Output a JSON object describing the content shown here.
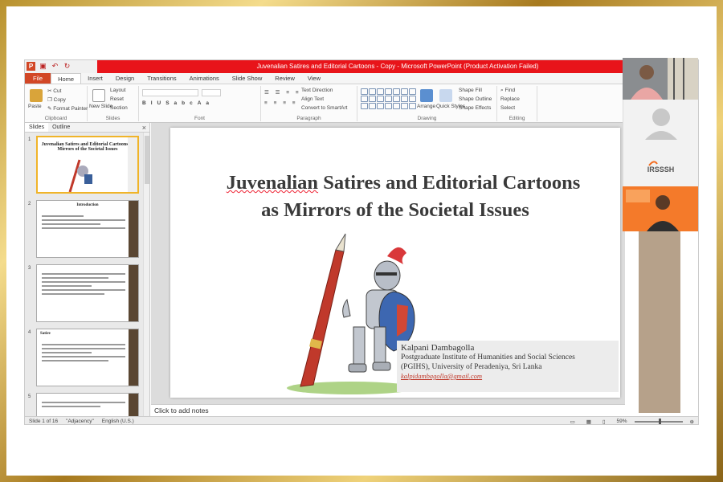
{
  "window": {
    "title": "Juvenalian Satires and Editorial Cartoons - Copy - Microsoft PowerPoint (Product Activation Failed)"
  },
  "ribbon_tabs": [
    "File",
    "Home",
    "Insert",
    "Design",
    "Transitions",
    "Animations",
    "Slide Show",
    "Review",
    "View"
  ],
  "ribbon": {
    "clipboard": {
      "paste": "Paste",
      "cut": "Cut",
      "copy": "Copy",
      "format_painter": "Format Painter",
      "label": "Clipboard"
    },
    "slides": {
      "new_slide": "New Slide",
      "layout": "Layout",
      "reset": "Reset",
      "section": "Section",
      "label": "Slides"
    },
    "font": {
      "label": "Font"
    },
    "paragraph": {
      "text_direction": "Text Direction",
      "align_text": "Align Text",
      "convert_smartart": "Convert to SmartArt",
      "label": "Paragraph"
    },
    "drawing": {
      "arrange": "Arrange",
      "quick_styles": "Quick Styles",
      "shape_fill": "Shape Fill",
      "shape_outline": "Shape Outline",
      "shape_effects": "Shape Effects",
      "label": "Drawing"
    },
    "editing": {
      "find": "Find",
      "replace": "Replace",
      "select": "Select",
      "label": "Editing"
    }
  },
  "pane": {
    "tabs": [
      "Slides",
      "Outline"
    ],
    "close_glyph": "×",
    "thumbnails": [
      {
        "num": "1",
        "title": "Juvenalian Satires and Editorial Cartoons as Mirrors of the Societal Issues"
      },
      {
        "num": "2",
        "title": "Introduction"
      },
      {
        "num": "3",
        "title": ""
      },
      {
        "num": "4",
        "title": "Satire"
      },
      {
        "num": "5",
        "title": ""
      }
    ]
  },
  "slide": {
    "title_line1_a": "Juvenalian",
    "title_line1_b": " Satires and  Editorial Cartoons",
    "title_line2": "as Mirrors of the Societal Issues",
    "author_name": "Kalpani Dambagolla",
    "author_line1": "Postgraduate Institute of Humanities and Social Sciences",
    "author_line2": "(PGIHS), University of Peradeniya, Sri Lanka",
    "author_email": "kalpidambagolla@gmail.com"
  },
  "notes": {
    "placeholder": "Click to add notes"
  },
  "status": {
    "slide_info": "Slide 1 of 16",
    "theme": "\"Adjacency\"",
    "language": "English (U.S.)",
    "zoom": "59%"
  },
  "video": {
    "badge": "IRSSSH"
  },
  "colors": {
    "title_bar": "#e8141a",
    "file_tab": "#d24726",
    "selected_thumb": "#f0b429",
    "frame_gold": "#c9a040"
  }
}
